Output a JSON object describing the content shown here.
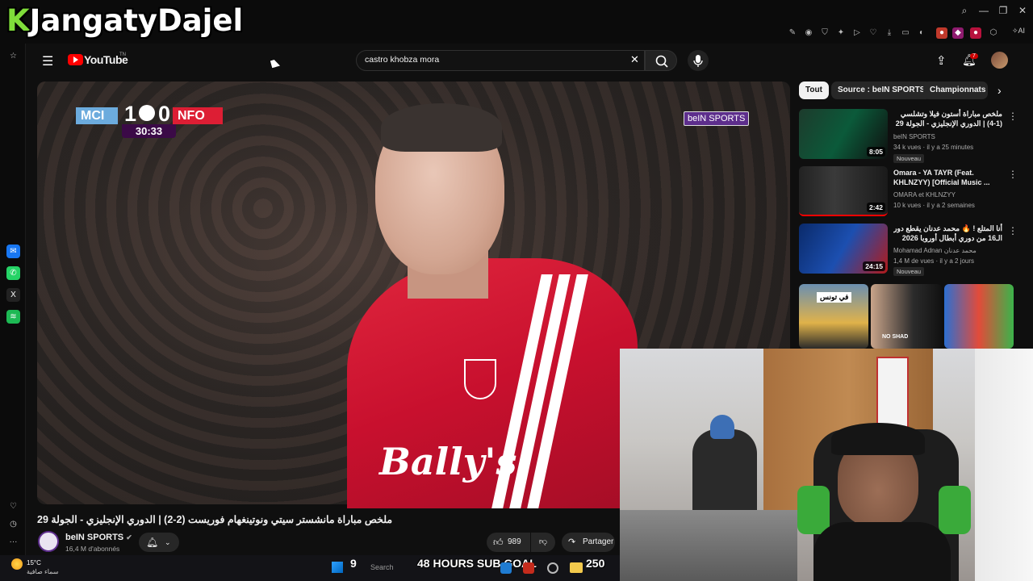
{
  "stream_overlay": {
    "logo_text": "KJangatyDajel"
  },
  "youtube": {
    "logo_text": "YouTube",
    "logo_country": "TN",
    "search": {
      "value": "castro khobza mora",
      "clear_icon": "close-icon",
      "search_icon": "search-icon",
      "mic_icon": "mic-icon"
    },
    "notifications_count": "7"
  },
  "video": {
    "title": "ملخص مباراة مانشستر سيتي ونوتينغهام فوريست (2-2) | الدوري الإنجليزي - الجولة 29",
    "scorebug": {
      "home": "MCI",
      "home_score": "1",
      "away_score": "0",
      "away": "NFO",
      "clock": "30:33"
    },
    "broadcaster_badge": "beIN SPORTS",
    "shirt_sponsor": "Bally's"
  },
  "channel": {
    "name": "beIN SPORTS",
    "subscribers": "16,4 M d'abonnés"
  },
  "actions": {
    "likes": "989",
    "share_label": "Partager"
  },
  "chips": [
    {
      "label": "Tout",
      "active": true
    },
    {
      "label": "Source : beIN SPORTS",
      "active": false
    },
    {
      "label": "Championnats",
      "active": false
    }
  ],
  "recommendations": [
    {
      "title": "ملخص مباراة أستون فيلا وتشلسي (1-4) | الدوري الإنجليزي - الجولة 29",
      "channel": "beIN SPORTS",
      "meta": "34 k vues · il y a 25 minutes",
      "badge": "Nouveau",
      "duration": "8:05"
    },
    {
      "title": "Omara - YA TAYR (Feat. KHLNZYY) [Official Music ...",
      "channel": "OMARA et KHLNZYY",
      "meta": "10 k vues · il y a 2 semaines",
      "badge": "",
      "duration": "2:42"
    },
    {
      "title": "أنا المتلع ! 🔥 محمد عدنان يقطع دور الـ16 من دوري أبطال أوروبا 2026",
      "channel": "Mohamad Adnan محمد عدنان",
      "meta": "1,4 M de vues · il y a 2 jours",
      "badge": "Nouveau",
      "duration": "24:15"
    }
  ],
  "shorts": [
    {
      "caption": "في تونس"
    },
    {
      "caption": "NO SHAD"
    },
    {
      "caption": ""
    }
  ],
  "taskbar": {
    "weather_temp": "15°C",
    "weather_desc": "سماء صافية",
    "search_placeholder": "Search",
    "goal_left": "9",
    "goal_text": "48 HOURS SUB GOAL",
    "goal_right": "250"
  },
  "colors": {
    "yt_red": "#ff0000",
    "bein_purple": "#5d2e8c",
    "mci_blue": "#6cabdd",
    "nfo_red": "#dd1e34",
    "logo_green": "#7fdc3a"
  }
}
